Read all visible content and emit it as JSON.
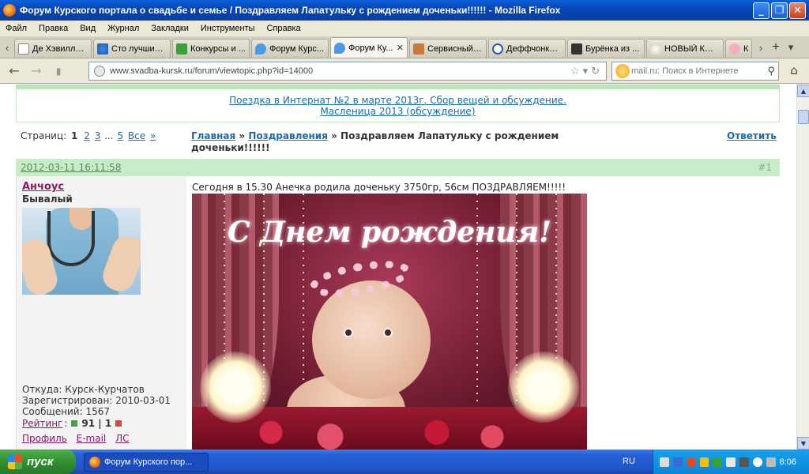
{
  "window": {
    "title": "Форум Курского портала о свадьбе и семье / Поздравляем Лапатульку с рождением доченьки!!!!!! - Mozilla Firefox"
  },
  "menu": [
    "Файл",
    "Правка",
    "Вид",
    "Журнал",
    "Закладки",
    "Инструменты",
    "Справка"
  ],
  "tabs": [
    {
      "label": "Де Хэвиллен..."
    },
    {
      "label": "Сто лучших ..."
    },
    {
      "label": "Конкурсы и ..."
    },
    {
      "label": "Форум Курс..."
    },
    {
      "label": "Форум Ку...",
      "active": true
    },
    {
      "label": "Сервисный ..."
    },
    {
      "label": "Деффчонки,..."
    },
    {
      "label": "Бурёнка из ..."
    },
    {
      "label": "НОВЫЙ КОН..."
    },
    {
      "label": "Ко"
    }
  ],
  "nav": {
    "url": "www.svadba-kursk.ru/forum/viewtopic.php?id=14000",
    "search_placeholder": "mail.ru: Поиск в Интернете"
  },
  "announce": {
    "line1": "Поездка в Интернат №2 в марте 2013г. Сбор вещей и обсуждение.",
    "line2": "Масленица 2013 (обсуждение)"
  },
  "pages": {
    "label": "Страниц:",
    "current": "1",
    "p2": "2",
    "p3": "3",
    "dots": "...",
    "p5": "5",
    "all": "Все",
    "next": "»"
  },
  "crumbs": {
    "home": "Главная",
    "sep": " » ",
    "section": "Поздравления",
    "topic": "Поздравляем Лапатульку с рождением доченьки!!!!!!"
  },
  "reply_label": "Ответить",
  "post": {
    "date": "2012-03-11 16:11:58",
    "number": "#1",
    "message": "Сегодня в 15.30 Анечка родила доченьку 3750гр, 56см ПОЗДРАВЛЯЕМ!!!!!",
    "image_caption": "С Днем рождения!"
  },
  "author": {
    "name": "Анчоус",
    "rank": "Бывалый",
    "from": "Откуда: Курск-Курчатов",
    "registered": "Зарегистрирован: 2010-03-01",
    "messages": "Сообщений: 1567",
    "rating_label": "Рейтинг",
    "rating_sep": ":",
    "rating_value": "91 | 1",
    "links": {
      "profile": "Профиль",
      "email": "E-mail",
      "pm": "ЛС"
    }
  },
  "taskbar": {
    "start": "пуск",
    "item": "Форум Курского пор...",
    "lang": "RU",
    "clock": "8:06"
  },
  "icons": {
    "back": "back-arrow-icon",
    "forward": "forward-arrow-icon",
    "home": "home-icon",
    "search": "magnifier-icon"
  }
}
